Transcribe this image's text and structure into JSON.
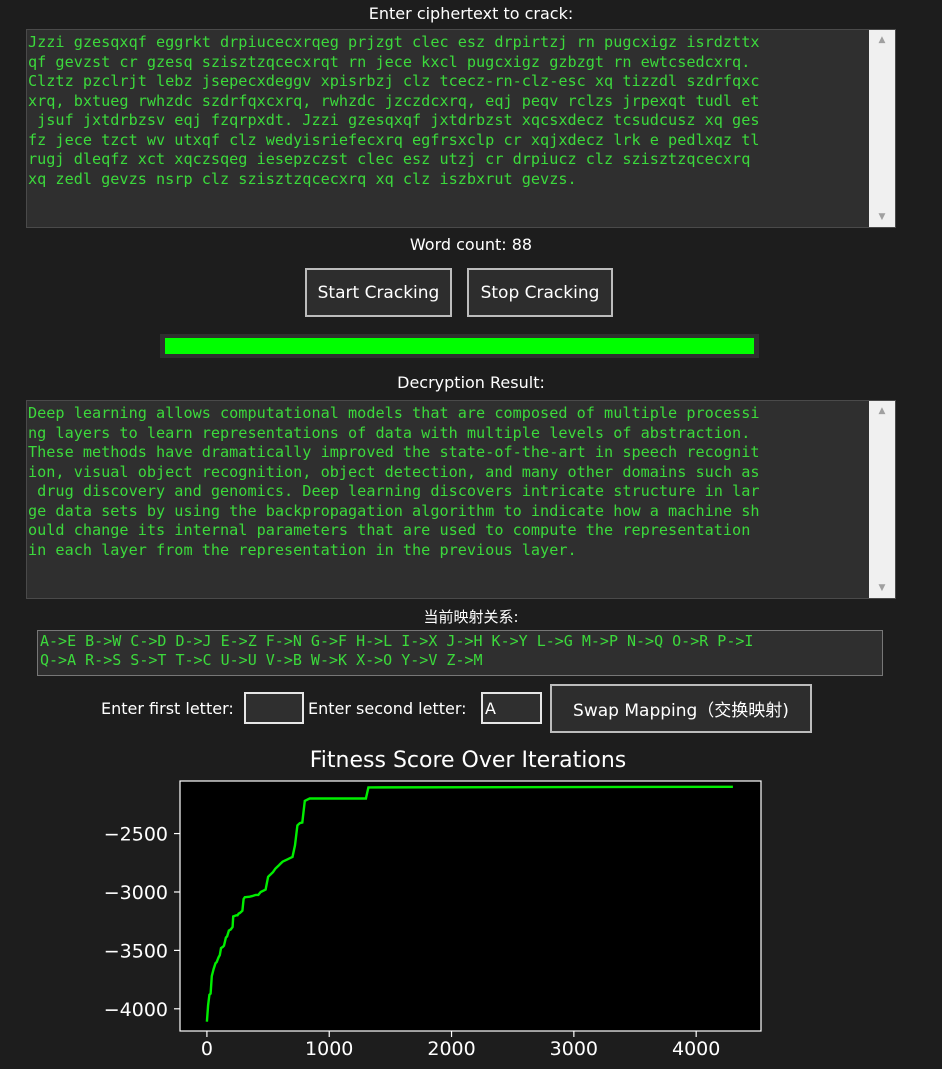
{
  "cipher": {
    "label": "Enter ciphertext to crack:",
    "lines": [
      "Jzzi gzesqxqf eggrkt drpiucecxrqeg prjzgt clec esz drpirtzj rn pugcxigz isrdzttx",
      "qf gevzst cr gzesq szisztzqcecxrqt rn jece kxcl pugcxigz gzbzgt rn ewtcsedcxrq.",
      "Clztz pzclrjt lebz jsepecxdeggv xpisrbzj clz tcecz-rn-clz-esc xq tizzdl szdrfqxc",
      "xrq, bxtueg rwhzdc szdrfqxcxrq, rwhzdc jzczdcxrq, eqj peqv rclzs jrpexqt tudl et",
      " jsuf jxtdrbzsv eqj fzqrpxdt. Jzzi gzesqxqf jxtdrbzst xqcsxdecz tcsudcusz xq ges",
      "fz jece tzct wv utxqf clz wedyisriefecxrq egfrsxclp cr xqjxdecz lrk e pedlxqz tl",
      "rugj dleqfz xct xqczsqeg iesepzczst clec esz utzj cr drpiucz clz szisztzqcecxrq",
      "xq zedl gevzs nsrp clz szisztzqcecxrq xq clz iszbxrut gevzs."
    ]
  },
  "word_count": "Word count: 88",
  "buttons": {
    "start": "Start Cracking",
    "stop": "Stop Cracking"
  },
  "progress": {
    "value": 1.0,
    "color": "#00ff00"
  },
  "result": {
    "label": "Decryption Result:",
    "lines": [
      "Deep learning allows computational models that are composed of multiple processi",
      "ng layers to learn representations of data with multiple levels of abstraction.",
      "These methods have dramatically improved the state-of-the-art in speech recognit",
      "ion, visual object recognition, object detection, and many other domains such as",
      " drug discovery and genomics. Deep learning discovers intricate structure in lar",
      "ge data sets by using the backpropagation algorithm to indicate how a machine sh",
      "ould change its internal parameters that are used to compute the representation",
      "in each layer from the representation in the previous layer."
    ]
  },
  "mapping": {
    "label": "当前映射关系:",
    "lines": [
      "A->E B->W C->D D->J E->Z F->N G->F H->L I->X J->H K->Y L->G M->P N->Q O->R P->I",
      "Q->A R->S S->T T->C U->U V->B W->K X->O Y->V Z->M"
    ]
  },
  "swap": {
    "first_label": "Enter first letter:",
    "first_value": "",
    "second_label": "Enter second letter:",
    "second_value": "A",
    "button": "Swap Mapping（交换映射)"
  },
  "chart_data": {
    "type": "line",
    "title": "Fitness Score Over Iterations",
    "xlabel": "",
    "ylabel": "",
    "xlim": [
      -220,
      4530
    ],
    "ylim": [
      -4190,
      -2050
    ],
    "xticks": [
      0,
      1000,
      2000,
      3000,
      4000
    ],
    "yticks": [
      -2500,
      -3000,
      -3500,
      -4000
    ],
    "ytick_labels": [
      "−2500",
      "−3000",
      "−3500",
      "−4000"
    ],
    "grid": false,
    "line_color": "#00ee00",
    "series": [
      {
        "x": [
          0,
          10,
          20,
          30,
          40,
          55,
          70,
          80,
          95,
          105,
          115,
          130,
          140,
          155,
          165,
          180,
          195,
          210,
          215,
          240,
          250,
          260,
          270,
          290,
          300,
          310,
          350,
          370,
          400,
          420,
          440,
          480,
          500,
          510,
          520,
          540,
          560,
          590,
          600,
          620,
          640,
          660,
          680,
          700,
          720,
          740,
          750,
          760,
          780,
          800,
          820,
          840,
          860,
          1300,
          1320,
          4300
        ],
        "y": [
          -4110,
          -3970,
          -3880,
          -3870,
          -3720,
          -3660,
          -3610,
          -3600,
          -3560,
          -3540,
          -3480,
          -3470,
          -3460,
          -3390,
          -3380,
          -3330,
          -3320,
          -3300,
          -3210,
          -3200,
          -3200,
          -3185,
          -3180,
          -3160,
          -3060,
          -3045,
          -3040,
          -3035,
          -3025,
          -3025,
          -3000,
          -2980,
          -2870,
          -2860,
          -2850,
          -2830,
          -2800,
          -2770,
          -2760,
          -2740,
          -2730,
          -2720,
          -2710,
          -2700,
          -2600,
          -2430,
          -2420,
          -2410,
          -2405,
          -2220,
          -2210,
          -2200,
          -2200,
          -2200,
          -2105,
          -2100
        ]
      }
    ]
  }
}
